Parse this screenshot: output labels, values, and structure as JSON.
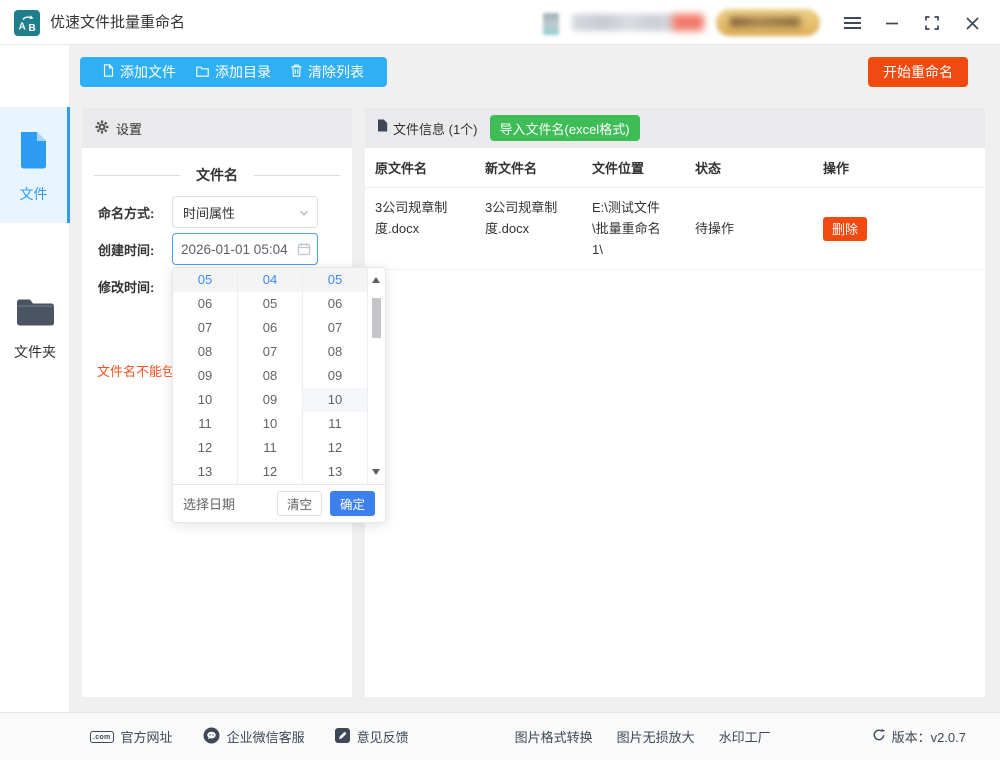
{
  "titlebar": {
    "title": "优速文件批量重命名"
  },
  "toolbar": {
    "add_file": "添加文件",
    "add_folder": "添加目录",
    "clear_list": "清除列表",
    "start_rename": "开始重命名"
  },
  "sidebar": {
    "items": [
      {
        "label": "文件",
        "active": true
      },
      {
        "label": "文件夹",
        "active": false
      }
    ]
  },
  "settings": {
    "header": "设置",
    "group_title": "文件名",
    "fields": {
      "naming_label": "命名方式:",
      "naming_value": "时间属性",
      "created_label": "创建时间:",
      "created_value": "2026-01-01 05:04",
      "modified_label": "修改时间:"
    },
    "warning": "文件名不能包"
  },
  "time_picker": {
    "columns": [
      {
        "items": [
          "05",
          "06",
          "07",
          "08",
          "09",
          "10",
          "11",
          "12",
          "13"
        ],
        "selected_index": 0,
        "hover_index": -1
      },
      {
        "items": [
          "04",
          "05",
          "06",
          "07",
          "08",
          "09",
          "10",
          "11",
          "12"
        ],
        "selected_index": 0,
        "hover_index": -1
      },
      {
        "items": [
          "05",
          "06",
          "07",
          "08",
          "09",
          "10",
          "11",
          "12",
          "13"
        ],
        "selected_index": 0,
        "hover_index": 5
      }
    ],
    "select_date": "选择日期",
    "clear": "清空",
    "confirm": "确定"
  },
  "file_panel": {
    "title": "文件信息 (1个)",
    "import_button": "导入文件名(excel格式)",
    "table": {
      "headers": [
        "原文件名",
        "新文件名",
        "文件位置",
        "状态",
        "操作"
      ],
      "rows": [
        {
          "original": "3公司规章制度.docx",
          "renamed": "3公司规章制度.docx",
          "location": "E:\\测试文件\\批量重命名1\\",
          "status": "待操作",
          "action": "删除"
        }
      ]
    }
  },
  "footer": {
    "site_link": "官方网址",
    "wechat_link": "企业微信客服",
    "feedback_link": "意见反馈",
    "tool_links": [
      "图片格式转换",
      "图片无损放大",
      "水印工厂"
    ],
    "version": "版本：v2.0.7"
  },
  "icons": {
    "app-icon": "A-to-B arrow badge",
    "menu-icon": "hamburger",
    "minimize-icon": "line",
    "maximize-icon": "corner brackets",
    "close-icon": "x",
    "add-file-icon": "document outline",
    "add-folder-icon": "folder outline",
    "clear-list-icon": "trash outline",
    "settings-icon": "gear",
    "file-icon": "blue document",
    "folder-icon": "dark folder",
    "file-info-icon": "dark document",
    "calendar-icon": "calendar",
    "chevron-down-icon": "chevron down",
    "scroll-up-icon": "triangle up",
    "scroll-down-icon": "triangle down",
    "website-icon": "com badge",
    "wechat-icon": "chat bubble circle",
    "feedback-icon": "pen square",
    "refresh-icon": "circular arrow"
  },
  "colors": {
    "toolbar_blue": "#2FB0F5",
    "accent_blue": "#3D87F5",
    "sidebar_blue": "#2E9BF2",
    "action_orange": "#F04A11",
    "import_green": "#3EBD57",
    "app_icon_teal": "#1F7E8C",
    "warning_red": "#F4511E"
  }
}
